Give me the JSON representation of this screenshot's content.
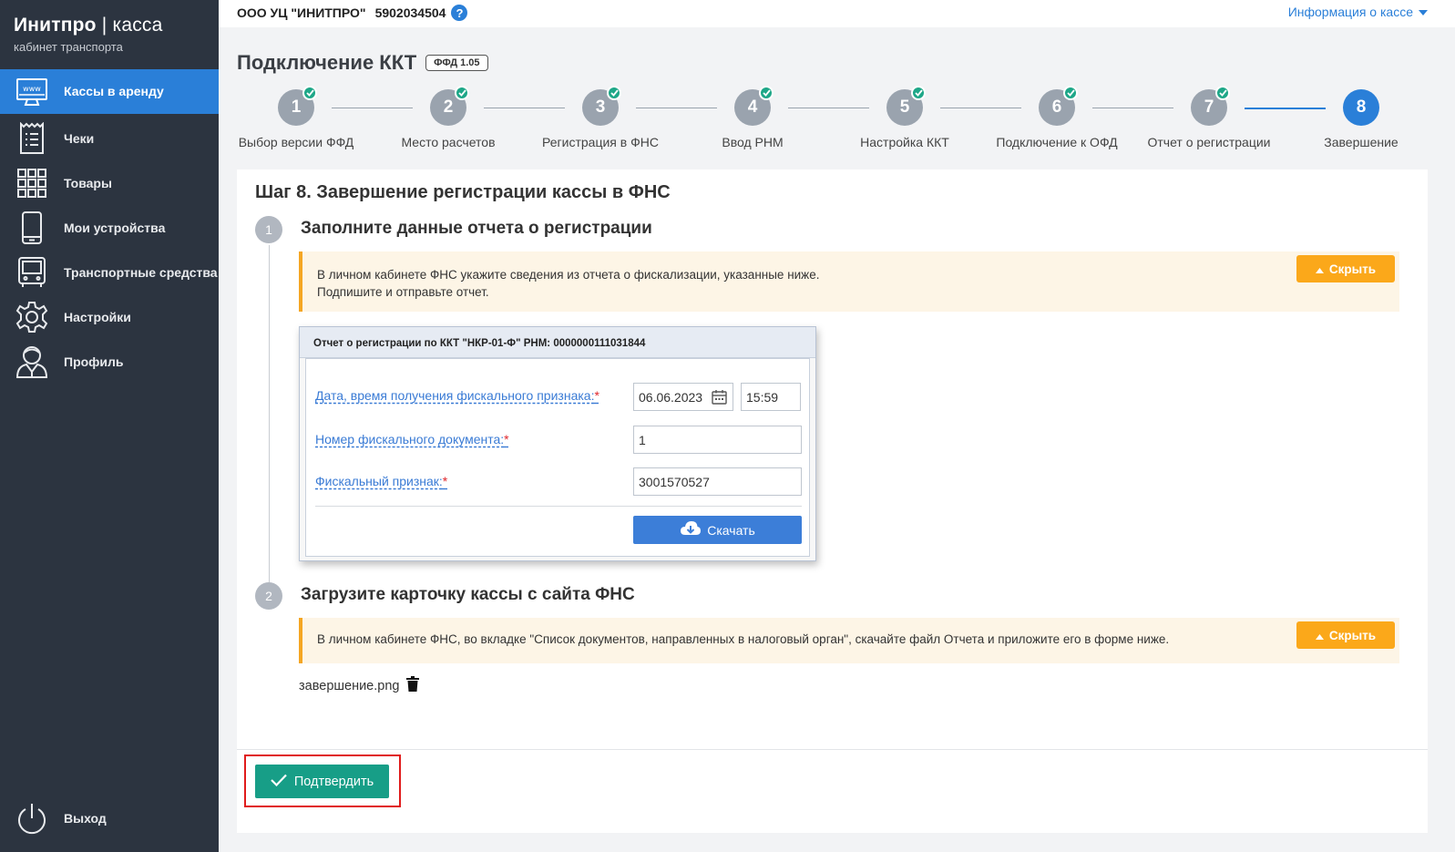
{
  "sidebar": {
    "brand_main": "Инитпро",
    "brand_sep": "|",
    "brand_light": "касса",
    "brand_sub": "кабинет транспорта",
    "items": [
      {
        "label": "Кассы в аренду",
        "icon": "www-monitor-icon"
      },
      {
        "label": "Чеки",
        "icon": "receipt-icon"
      },
      {
        "label": "Товары",
        "icon": "grid-icon"
      },
      {
        "label": "Мои устройства",
        "icon": "phone-icon"
      },
      {
        "label": "Транспортные средства",
        "icon": "bus-icon"
      },
      {
        "label": "Настройки",
        "icon": "gear-icon"
      },
      {
        "label": "Профиль",
        "icon": "user-icon"
      }
    ],
    "logout": "Выход"
  },
  "topbar": {
    "org_name": "ООО УЦ \"ИНИТПРО\"",
    "inn": "5902034504",
    "help": "?",
    "info_link": "Информация о кассе"
  },
  "page": {
    "title": "Подключение ККТ",
    "ffd_badge": "ФФД 1.05"
  },
  "stepper": {
    "steps": [
      {
        "num": "1",
        "label": "Выбор версии ФФД",
        "done": true
      },
      {
        "num": "2",
        "label": "Место расчетов",
        "done": true
      },
      {
        "num": "3",
        "label": "Регистрация в ФНС",
        "done": true
      },
      {
        "num": "4",
        "label": "Ввод РНМ",
        "done": true
      },
      {
        "num": "5",
        "label": "Настройка ККТ",
        "done": true
      },
      {
        "num": "6",
        "label": "Подключение к ОФД",
        "done": true
      },
      {
        "num": "7",
        "label": "Отчет о регистрации",
        "done": true
      },
      {
        "num": "8",
        "label": "Завершение",
        "done": false
      }
    ]
  },
  "main": {
    "step_title": "Шаг 8. Завершение регистрации кассы в ФНС",
    "sub1": {
      "num": "1",
      "title": "Заполните данные отчета о регистрации",
      "note_line1": "В личном кабинете ФНС укажите сведения из отчета о фискализации, указанные ниже.",
      "note_line2": "Подпишите и отправьте отчет.",
      "hide_label": "Скрыть"
    },
    "report": {
      "header": "Отчет о регистрации по ККТ \"НКР-01-Ф\" РНМ: 0000000111031844",
      "date_label": "Дата, время получения фискального признака:",
      "date_value": "06.06.2023",
      "time_value": "15:59",
      "doc_label": "Номер фискального документа:",
      "doc_value": "1",
      "sign_label": "Фискальный признак:",
      "sign_value": "3001570527",
      "required_mark": "*",
      "download_label": "Скачать"
    },
    "sub2": {
      "num": "2",
      "title": "Загрузите карточку кассы с сайта ФНС",
      "note": "В личном кабинете ФНС, во вкладке \"Список документов, направленных в налоговый орган\", скачайте файл Отчета и приложите его в форме ниже.",
      "hide_label": "Скрыть"
    },
    "file_name": "завершение.png",
    "confirm_label": "Подтвердить"
  },
  "colors": {
    "sidebar_bg": "#2c3440",
    "accent_blue": "#2a7fd8",
    "done_green": "#1ea788",
    "warning_orange": "#fba81a",
    "confirm_teal": "#179e87",
    "highlight_red": "#e01b1b"
  }
}
